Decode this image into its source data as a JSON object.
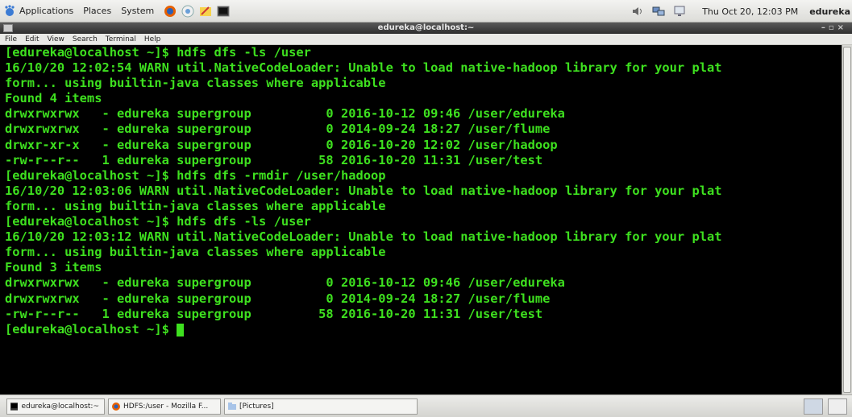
{
  "top_panel": {
    "menus": [
      "Applications",
      "Places",
      "System"
    ],
    "clock": "Thu Oct 20, 12:03 PM",
    "user": "edureka"
  },
  "window": {
    "title": "edureka@localhost:~"
  },
  "menubar": [
    "File",
    "Edit",
    "View",
    "Search",
    "Terminal",
    "Help"
  ],
  "terminal": {
    "lines": [
      "[edureka@localhost ~]$ hdfs dfs -ls /user",
      "16/10/20 12:02:54 WARN util.NativeCodeLoader: Unable to load native-hadoop library for your plat",
      "form... using builtin-java classes where applicable",
      "Found 4 items",
      "drwxrwxrwx   - edureka supergroup          0 2016-10-12 09:46 /user/edureka",
      "drwxrwxrwx   - edureka supergroup          0 2014-09-24 18:27 /user/flume",
      "drwxr-xr-x   - edureka supergroup          0 2016-10-20 12:02 /user/hadoop",
      "-rw-r--r--   1 edureka supergroup         58 2016-10-20 11:31 /user/test",
      "[edureka@localhost ~]$ hdfs dfs -rmdir /user/hadoop",
      "16/10/20 12:03:06 WARN util.NativeCodeLoader: Unable to load native-hadoop library for your plat",
      "form... using builtin-java classes where applicable",
      "[edureka@localhost ~]$ hdfs dfs -ls /user",
      "16/10/20 12:03:12 WARN util.NativeCodeLoader: Unable to load native-hadoop library for your plat",
      "form... using builtin-java classes where applicable",
      "Found 3 items",
      "drwxrwxrwx   - edureka supergroup          0 2016-10-12 09:46 /user/edureka",
      "drwxrwxrwx   - edureka supergroup          0 2014-09-24 18:27 /user/flume",
      "-rw-r--r--   1 edureka supergroup         58 2016-10-20 11:31 /user/test"
    ],
    "prompt": "[edureka@localhost ~]$ ",
    "text_color": "#3ee01f",
    "background": "#000000"
  },
  "taskbar": [
    {
      "label": "edureka@localhost:~",
      "icon": "terminal-icon"
    },
    {
      "label": "HDFS:/user - Mozilla F...",
      "icon": "firefox-icon"
    },
    {
      "label": "[Pictures]",
      "icon": "folder-icon"
    }
  ]
}
